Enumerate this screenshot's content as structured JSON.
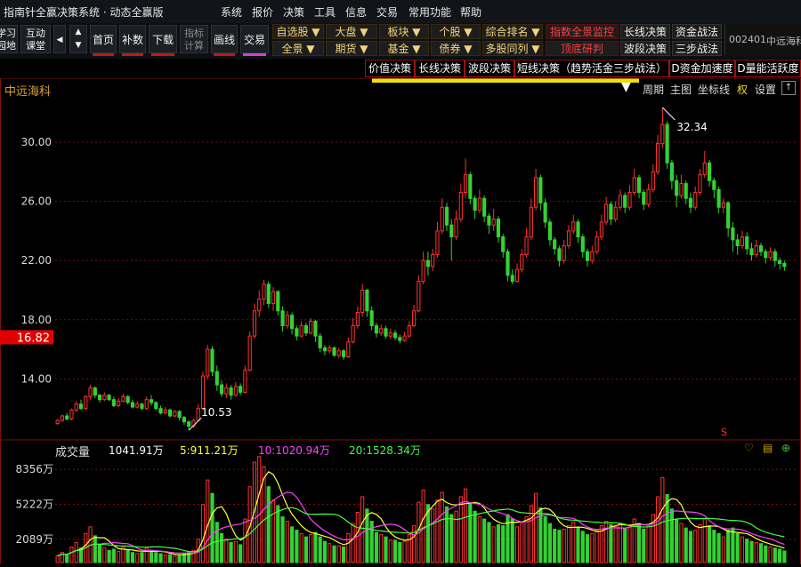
{
  "app": {
    "title": "指南针全赢决策系统 · 动态全赢版",
    "menu": [
      "系统",
      "报价",
      "决策",
      "工具",
      "信息",
      "交易",
      "常用功能",
      "帮助"
    ]
  },
  "toolbar": {
    "buttons": [
      {
        "label": "学习\n园地"
      },
      {
        "label": "互动\n课堂"
      },
      {
        "label": "首页"
      },
      {
        "label": "补数"
      },
      {
        "label": "下载"
      },
      {
        "label": "指标\n计算"
      },
      {
        "label": "画线"
      },
      {
        "label": "交易"
      }
    ],
    "dropdowns_row1": [
      "自选股 ▼",
      "大盘 ▼",
      "板块 ▼",
      "个股 ▼",
      "综合排名 ▼"
    ],
    "dropdowns_row2": [
      "全景 ▼",
      "期货 ▼",
      "基金 ▼",
      "债券 ▼",
      "多股同列 ▼"
    ],
    "red_buttons": [
      "指数全景监控",
      "顶底研判"
    ],
    "right_buttons_row1": [
      "长线决策",
      "资金战法"
    ],
    "right_buttons_row2": [
      "波段决策",
      "三步战法"
    ],
    "stock_code": "002401",
    "stock_name": "中远海科"
  },
  "strategy_tabs": [
    "价值决策",
    "长线决策",
    "波段决策",
    "短线决策（趋势活金三步战法）",
    "D资金加速度",
    "D量能活跃度"
  ],
  "chart_header": {
    "stock_name": "中远海科",
    "controls": [
      "周期",
      "主图",
      "坐标线",
      "权",
      "设置"
    ]
  },
  "price_axis": {
    "ticks": [
      "30.00",
      "26.00",
      "22.00",
      "18.00",
      "14.00"
    ],
    "tick_values": [
      30,
      26,
      22,
      18,
      14
    ],
    "current_price_label": "16.82",
    "current_price": 16.82,
    "low_annotation": "10.53",
    "high_annotation": "32.34",
    "s_marker": "S"
  },
  "volume_header": {
    "label": "成交量",
    "value": "1041.91万",
    "ma5": "5:911.21万",
    "ma10": "10:1020.94万",
    "ma20": "20:1528.34万"
  },
  "volume_axis": {
    "ticks": [
      "8356万",
      "5222万",
      "2089万"
    ],
    "tick_values": [
      8356,
      5222,
      2089
    ]
  },
  "colors": {
    "up": "#ff3232",
    "down": "#32d232",
    "ma5": "#ffff40",
    "ma10": "#ff40ff",
    "ma20": "#40ff40",
    "grid": "#7a1010",
    "price_label": "#d8d8d8"
  },
  "chart_data": {
    "type": "candlestick",
    "price_range": [
      10,
      33
    ],
    "volume_range": [
      0,
      9800
    ],
    "candles": [
      [
        11.0,
        11.2,
        10.9,
        11.3,
        600
      ],
      [
        11.2,
        11.5,
        11.1,
        11.6,
        900
      ],
      [
        11.5,
        11.3,
        11.2,
        11.7,
        700
      ],
      [
        11.3,
        11.9,
        11.2,
        12.0,
        1400
      ],
      [
        11.9,
        12.3,
        11.8,
        12.5,
        1800
      ],
      [
        12.3,
        12.0,
        11.9,
        12.6,
        1300
      ],
      [
        12.0,
        12.8,
        11.9,
        12.9,
        2600
      ],
      [
        12.8,
        13.4,
        12.6,
        13.6,
        3200
      ],
      [
        13.4,
        12.9,
        12.7,
        13.5,
        2400
      ],
      [
        12.9,
        12.6,
        12.4,
        13.0,
        1600
      ],
      [
        12.6,
        12.9,
        12.5,
        13.1,
        1300
      ],
      [
        12.9,
        12.6,
        12.5,
        13.0,
        1100
      ],
      [
        12.6,
        12.2,
        12.1,
        12.8,
        1200
      ],
      [
        12.2,
        12.5,
        12.1,
        12.7,
        1000
      ],
      [
        12.5,
        12.8,
        12.4,
        13.0,
        1400
      ],
      [
        12.8,
        12.4,
        12.3,
        12.9,
        1100
      ],
      [
        12.4,
        12.1,
        12.0,
        12.6,
        900
      ],
      [
        12.1,
        12.3,
        12.0,
        12.5,
        800
      ],
      [
        12.3,
        12.0,
        11.9,
        12.4,
        900
      ],
      [
        12.0,
        12.6,
        11.9,
        12.8,
        1300
      ],
      [
        12.6,
        12.4,
        12.2,
        12.9,
        1100
      ],
      [
        12.4,
        12.0,
        11.9,
        12.5,
        900
      ],
      [
        12.0,
        11.7,
        11.6,
        12.2,
        800
      ],
      [
        11.7,
        11.9,
        11.6,
        12.1,
        700
      ],
      [
        11.9,
        11.5,
        11.4,
        12.0,
        700
      ],
      [
        11.5,
        11.8,
        11.4,
        11.9,
        600
      ],
      [
        11.8,
        11.4,
        11.2,
        11.9,
        700
      ],
      [
        11.4,
        11.1,
        10.9,
        11.5,
        800
      ],
      [
        11.1,
        10.8,
        10.53,
        11.2,
        900
      ],
      [
        10.8,
        11.2,
        10.7,
        11.3,
        1100
      ],
      [
        11.2,
        12.0,
        11.1,
        12.3,
        2100
      ],
      [
        12.0,
        14.2,
        11.9,
        14.5,
        5200
      ],
      [
        14.2,
        16.0,
        14.0,
        16.3,
        7400
      ],
      [
        16.0,
        14.5,
        14.2,
        16.2,
        6200
      ],
      [
        14.5,
        13.6,
        13.2,
        14.9,
        3600
      ],
      [
        13.6,
        13.0,
        12.8,
        13.9,
        2600
      ],
      [
        13.0,
        13.4,
        12.7,
        13.7,
        2100
      ],
      [
        13.4,
        12.9,
        12.6,
        13.6,
        1800
      ],
      [
        12.9,
        13.5,
        12.8,
        13.8,
        1900
      ],
      [
        13.5,
        13.1,
        12.9,
        13.7,
        1600
      ],
      [
        13.1,
        14.6,
        13.0,
        14.9,
        3900
      ],
      [
        14.6,
        16.9,
        14.5,
        17.2,
        6800
      ],
      [
        16.9,
        18.6,
        16.7,
        19.1,
        9000
      ],
      [
        18.6,
        19.4,
        18.2,
        20.0,
        9500
      ],
      [
        19.4,
        20.4,
        19.0,
        20.7,
        8600
      ],
      [
        20.4,
        19.1,
        18.8,
        20.6,
        6800
      ],
      [
        19.1,
        19.9,
        18.6,
        20.2,
        5600
      ],
      [
        19.9,
        18.6,
        18.3,
        20.0,
        5100
      ],
      [
        18.6,
        17.6,
        17.2,
        18.9,
        4100
      ],
      [
        17.6,
        18.3,
        17.4,
        18.6,
        3700
      ],
      [
        18.3,
        17.4,
        17.0,
        18.5,
        3200
      ],
      [
        17.4,
        16.9,
        16.6,
        17.6,
        2900
      ],
      [
        16.9,
        17.6,
        16.8,
        17.9,
        2600
      ],
      [
        17.6,
        17.1,
        16.9,
        17.8,
        2300
      ],
      [
        17.1,
        17.9,
        17.0,
        18.1,
        2500
      ],
      [
        17.9,
        16.9,
        16.5,
        18.0,
        2700
      ],
      [
        16.9,
        16.1,
        15.8,
        17.1,
        2300
      ],
      [
        16.1,
        15.9,
        15.6,
        16.3,
        1900
      ],
      [
        15.9,
        16.1,
        15.7,
        16.3,
        1700
      ],
      [
        16.1,
        15.6,
        15.5,
        16.2,
        1500
      ],
      [
        15.6,
        15.9,
        15.4,
        16.1,
        1500
      ],
      [
        15.9,
        15.5,
        15.3,
        16.0,
        1400
      ],
      [
        15.5,
        16.5,
        15.4,
        16.8,
        2600
      ],
      [
        16.5,
        17.6,
        16.4,
        18.1,
        3500
      ],
      [
        17.6,
        18.5,
        17.4,
        18.9,
        4500
      ],
      [
        18.5,
        20.0,
        18.2,
        20.4,
        5900
      ],
      [
        20.0,
        18.6,
        18.2,
        20.1,
        4800
      ],
      [
        18.6,
        17.6,
        17.3,
        18.9,
        3700
      ],
      [
        17.6,
        17.1,
        16.8,
        17.8,
        2700
      ],
      [
        17.1,
        17.4,
        16.9,
        17.7,
        2500
      ],
      [
        17.4,
        16.9,
        16.7,
        17.6,
        2300
      ],
      [
        16.9,
        17.1,
        16.7,
        17.4,
        2000
      ],
      [
        17.1,
        16.8,
        16.6,
        17.3,
        2000
      ],
      [
        16.8,
        16.6,
        16.4,
        17.0,
        1800
      ],
      [
        16.6,
        16.9,
        16.5,
        17.2,
        1900
      ],
      [
        16.9,
        17.6,
        16.8,
        17.9,
        2500
      ],
      [
        17.6,
        18.6,
        17.5,
        19.0,
        3300
      ],
      [
        18.6,
        20.6,
        18.5,
        21.0,
        5400
      ],
      [
        20.6,
        22.0,
        20.4,
        22.6,
        6500
      ],
      [
        22.0,
        21.6,
        21.0,
        22.6,
        5200
      ],
      [
        21.6,
        22.4,
        21.3,
        22.8,
        4800
      ],
      [
        22.4,
        24.0,
        22.2,
        24.6,
        5600
      ],
      [
        24.0,
        25.6,
        23.8,
        26.2,
        6300
      ],
      [
        25.6,
        24.4,
        24.0,
        25.9,
        5000
      ],
      [
        24.4,
        23.6,
        22.0,
        24.8,
        4300
      ],
      [
        23.6,
        24.8,
        23.4,
        25.4,
        4600
      ],
      [
        24.8,
        26.6,
        24.6,
        27.2,
        5900
      ],
      [
        26.6,
        27.8,
        26.2,
        28.9,
        6600
      ],
      [
        27.8,
        26.2,
        25.8,
        28.0,
        5300
      ],
      [
        26.2,
        25.4,
        24.8,
        26.4,
        4600
      ],
      [
        25.4,
        26.2,
        25.2,
        26.8,
        4100
      ],
      [
        26.2,
        25.0,
        24.6,
        26.4,
        3900
      ],
      [
        25.0,
        24.4,
        23.8,
        25.2,
        3600
      ],
      [
        24.4,
        24.8,
        24.0,
        25.5,
        3200
      ],
      [
        24.8,
        23.6,
        23.2,
        25.0,
        3400
      ],
      [
        23.6,
        22.6,
        22.2,
        23.8,
        3300
      ],
      [
        22.6,
        21.0,
        20.6,
        22.8,
        4300
      ],
      [
        21.0,
        20.6,
        20.4,
        21.4,
        3900
      ],
      [
        20.6,
        21.4,
        20.5,
        21.8,
        3200
      ],
      [
        21.4,
        22.4,
        21.2,
        22.8,
        3500
      ],
      [
        22.4,
        23.6,
        22.2,
        24.2,
        4100
      ],
      [
        23.6,
        25.6,
        23.4,
        26.2,
        5100
      ],
      [
        25.6,
        27.6,
        25.4,
        28.2,
        6200
      ],
      [
        27.6,
        25.9,
        25.4,
        27.8,
        4900
      ],
      [
        25.9,
        24.6,
        24.2,
        26.2,
        4100
      ],
      [
        24.6,
        23.4,
        23.0,
        24.8,
        3500
      ],
      [
        23.4,
        22.8,
        22.4,
        23.6,
        3000
      ],
      [
        22.8,
        22.0,
        21.6,
        23.0,
        2900
      ],
      [
        22.0,
        23.0,
        21.8,
        23.4,
        3000
      ],
      [
        23.0,
        24.0,
        22.8,
        24.4,
        3300
      ],
      [
        24.0,
        24.6,
        23.8,
        25.1,
        3600
      ],
      [
        24.6,
        23.6,
        23.2,
        24.8,
        3100
      ],
      [
        23.6,
        22.6,
        22.2,
        23.8,
        2800
      ],
      [
        22.6,
        22.0,
        21.6,
        22.8,
        2500
      ],
      [
        22.0,
        22.6,
        21.8,
        23.0,
        2600
      ],
      [
        22.6,
        23.6,
        22.4,
        24.0,
        2900
      ],
      [
        23.6,
        24.6,
        23.4,
        25.1,
        3300
      ],
      [
        24.6,
        25.8,
        24.4,
        26.3,
        3700
      ],
      [
        25.8,
        24.8,
        24.4,
        26.0,
        3400
      ],
      [
        24.8,
        25.6,
        24.6,
        26.0,
        3200
      ],
      [
        25.6,
        26.4,
        25.4,
        26.8,
        3500
      ],
      [
        26.4,
        25.6,
        25.2,
        26.6,
        3100
      ],
      [
        25.6,
        26.6,
        25.4,
        27.1,
        3400
      ],
      [
        26.6,
        27.6,
        26.4,
        28.2,
        3900
      ],
      [
        27.6,
        26.6,
        26.2,
        27.8,
        3500
      ],
      [
        26.6,
        25.8,
        25.4,
        26.8,
        3000
      ],
      [
        25.8,
        26.8,
        25.6,
        27.2,
        3300
      ],
      [
        26.8,
        28.0,
        26.6,
        28.5,
        4300
      ],
      [
        28.0,
        29.9,
        27.8,
        30.5,
        5900
      ],
      [
        29.9,
        31.2,
        29.6,
        32.34,
        7600
      ],
      [
        31.2,
        28.6,
        28.2,
        31.4,
        6100
      ],
      [
        28.6,
        27.4,
        26.8,
        28.8,
        4800
      ],
      [
        27.4,
        26.4,
        25.6,
        27.8,
        3900
      ],
      [
        26.4,
        27.2,
        26.2,
        27.8,
        3500
      ],
      [
        27.2,
        26.2,
        25.8,
        27.4,
        3100
      ],
      [
        26.2,
        25.6,
        25.2,
        26.6,
        2800
      ],
      [
        25.6,
        26.6,
        25.4,
        27.0,
        2900
      ],
      [
        26.6,
        27.8,
        26.4,
        28.2,
        3400
      ],
      [
        27.8,
        28.6,
        27.6,
        29.4,
        3900
      ],
      [
        28.6,
        27.4,
        27.0,
        28.8,
        3300
      ],
      [
        27.4,
        26.8,
        26.2,
        27.6,
        2900
      ],
      [
        26.8,
        25.6,
        25.2,
        27.0,
        2600
      ],
      [
        25.6,
        25.9,
        25.2,
        26.2,
        2300
      ],
      [
        25.9,
        24.2,
        23.6,
        26.0,
        2900
      ],
      [
        24.2,
        23.4,
        22.6,
        24.6,
        3100
      ],
      [
        23.4,
        23.0,
        22.4,
        23.8,
        2600
      ],
      [
        23.0,
        23.6,
        22.8,
        24.0,
        2300
      ],
      [
        23.6,
        22.8,
        22.4,
        23.9,
        2100
      ],
      [
        22.8,
        22.4,
        22.0,
        23.2,
        1900
      ],
      [
        22.4,
        23.0,
        22.2,
        23.4,
        1800
      ],
      [
        23.0,
        22.6,
        22.3,
        23.2,
        1700
      ],
      [
        22.6,
        22.2,
        21.8,
        22.8,
        1500
      ],
      [
        22.2,
        22.6,
        22.0,
        22.9,
        1400
      ],
      [
        22.6,
        22.0,
        21.6,
        22.8,
        1300
      ],
      [
        22.0,
        21.8,
        21.4,
        22.2,
        1200
      ],
      [
        21.8,
        21.6,
        21.3,
        22.0,
        1041.91
      ]
    ]
  }
}
